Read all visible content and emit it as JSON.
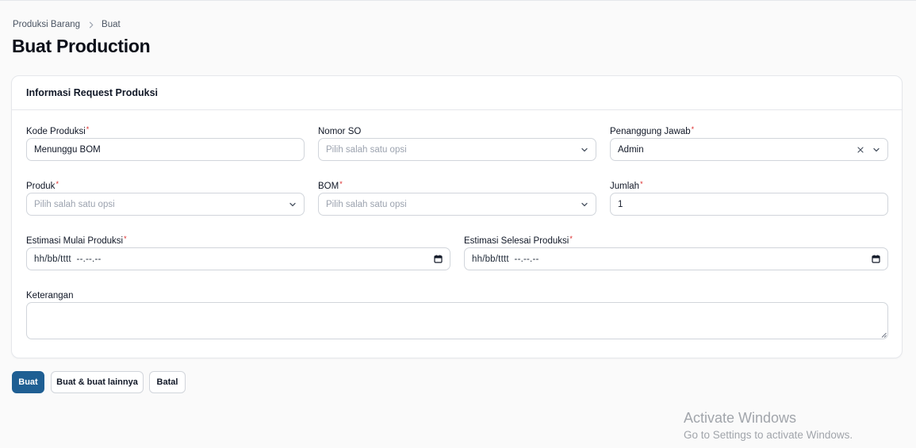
{
  "breadcrumb": {
    "parent": "Produksi Barang",
    "current": "Buat"
  },
  "page_title": "Buat Production",
  "card": {
    "title": "Informasi Request Produksi"
  },
  "form": {
    "kode_produksi": {
      "label": "Kode Produksi",
      "required": "*",
      "value": "Menunggu BOM"
    },
    "nomor_so": {
      "label": "Nomor SO",
      "placeholder": "Pilih salah satu opsi"
    },
    "penanggung_jawab": {
      "label": "Penanggung Jawab",
      "required": "*",
      "value": "Admin"
    },
    "produk": {
      "label": "Produk",
      "required": "*",
      "placeholder": "Pilih salah satu opsi"
    },
    "bom": {
      "label": "BOM",
      "required": "*",
      "placeholder": "Pilih salah satu opsi"
    },
    "jumlah": {
      "label": "Jumlah",
      "required": "*",
      "value": "1"
    },
    "estimasi_mulai": {
      "label": "Estimasi Mulai Produksi",
      "required": "*",
      "value": "hh/bb/tttt  --.--.--"
    },
    "estimasi_selesai": {
      "label": "Estimasi Selesai Produksi",
      "required": "*",
      "value": "hh/bb/tttt  --.--.--"
    },
    "keterangan": {
      "label": "Keterangan",
      "value": ""
    }
  },
  "actions": {
    "create": "Buat",
    "create_another": "Buat & buat lainnya",
    "cancel": "Batal"
  },
  "watermark": {
    "title": "Activate Windows",
    "subtitle": "Go to Settings to activate Windows."
  },
  "colors": {
    "primary": "#1f5f93",
    "required": "#dc2626",
    "border": "#d1d5db"
  },
  "icons": [
    "chevron-right-icon",
    "chevron-down-icon",
    "close-icon",
    "calendar-icon",
    "resize-handle-icon"
  ]
}
